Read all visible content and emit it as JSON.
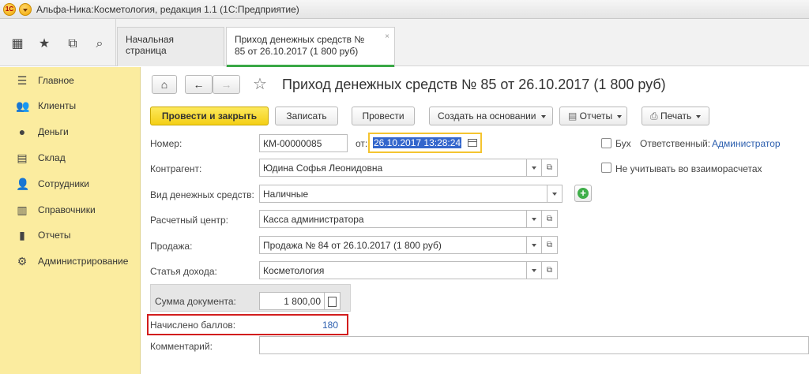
{
  "window": {
    "title": "Альфа-Ника:Косметология, редакция 1.1  (1С:Предприятие)"
  },
  "tabs": [
    {
      "label": "Начальная страница"
    },
    {
      "label_line1": "Приход денежных средств №",
      "label_line2": "85 от 26.10.2017 (1 800 руб)",
      "close": "×"
    }
  ],
  "sidebar": {
    "items": [
      {
        "label": "Главное",
        "icon": "menu-lines-icon"
      },
      {
        "label": "Клиенты",
        "icon": "users-icon"
      },
      {
        "label": "Деньги",
        "icon": "coin-icon"
      },
      {
        "label": "Склад",
        "icon": "warehouse-icon"
      },
      {
        "label": "Сотрудники",
        "icon": "person-icon"
      },
      {
        "label": "Справочники",
        "icon": "book-icon"
      },
      {
        "label": "Отчеты",
        "icon": "bar-chart-icon"
      },
      {
        "label": "Администрирование",
        "icon": "gear-icon"
      }
    ]
  },
  "document": {
    "title": "Приход денежных средств № 85 от 26.10.2017 (1 800 руб)"
  },
  "toolbar": {
    "post_close": "Провести и закрыть",
    "save": "Записать",
    "post": "Провести",
    "create_based": "Создать на основании",
    "reports": "Отчеты",
    "print": "Печать"
  },
  "form": {
    "number_label": "Номер:",
    "number_value": "КМ-00000085",
    "date_label": "от:",
    "date_value": "26.10.2017 13:28:24",
    "counterparty_label": "Контрагент:",
    "counterparty_value": "Юдина Софья Леонидовна",
    "money_type_label": "Вид денежных средств:",
    "money_type_value": "Наличные",
    "center_label": "Расчетный центр:",
    "center_value": "Касса администратора",
    "sale_label": "Продажа:",
    "sale_value": "Продажа № 84 от 26.10.2017 (1 800 руб)",
    "income_label": "Статья дохода:",
    "income_value": "Косметология",
    "sum_label": "Сумма документа:",
    "sum_value": "1 800,00",
    "bonus_label": "Начислено баллов:",
    "bonus_value": "180",
    "comment_label": "Комментарий:",
    "buh_label": "Бух",
    "responsible_label": "Ответственный:",
    "responsible_value": "Администратор",
    "mutual_label": "Не учитывать во взаиморасчетах"
  }
}
